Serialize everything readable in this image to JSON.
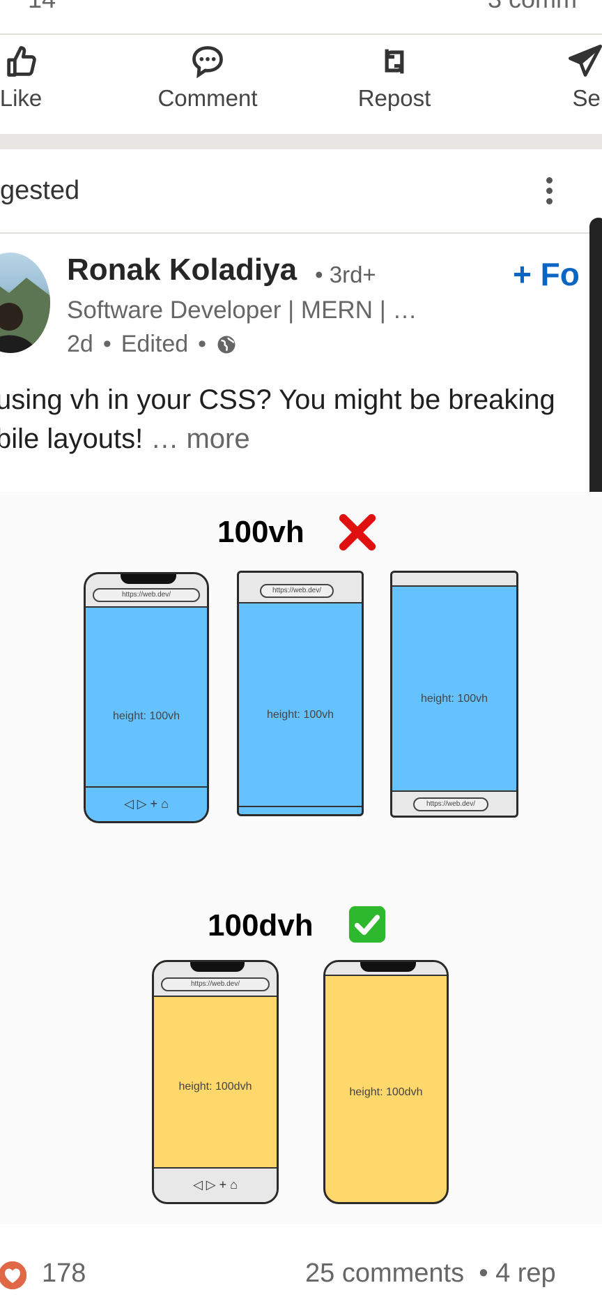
{
  "top": {
    "left_count": "14",
    "right_text": "3 comm"
  },
  "actions": [
    {
      "label": "Like",
      "icon": "like-icon"
    },
    {
      "label": "Comment",
      "icon": "comment-icon"
    },
    {
      "label": "Repost",
      "icon": "repost-icon"
    },
    {
      "label": "Send",
      "icon": "send-icon"
    }
  ],
  "section": {
    "title": "gested",
    "menu_icon": "more-vertical-icon"
  },
  "post": {
    "author": "Ronak Koladiya",
    "degree": "• 3rd+",
    "follow_label": "+ Fo",
    "headline": "Software Developer | MERN | …",
    "time": "2d",
    "edited": "Edited",
    "visibility_icon": "globe-icon",
    "text": "using vh in your CSS? You might be breaking",
    "text2": "bile layouts!",
    "more": "… more"
  },
  "image": {
    "title_bad": "100vh",
    "title_good": "100dvh",
    "label_vh": "height: 100vh",
    "label_dvh": "height: 100dvh",
    "url": "https://web.dev/",
    "colors": {
      "vh": "#66c2ff",
      "dvh": "#ffd86b",
      "bad": "#e01010",
      "good": "#2eb82e"
    }
  },
  "footer": {
    "reactions": "178",
    "comments": "25 comments",
    "reposts": "• 4 rep",
    "reaction_icon": "heart-reaction-icon"
  },
  "colors": {
    "accent": "#0a66c2"
  }
}
